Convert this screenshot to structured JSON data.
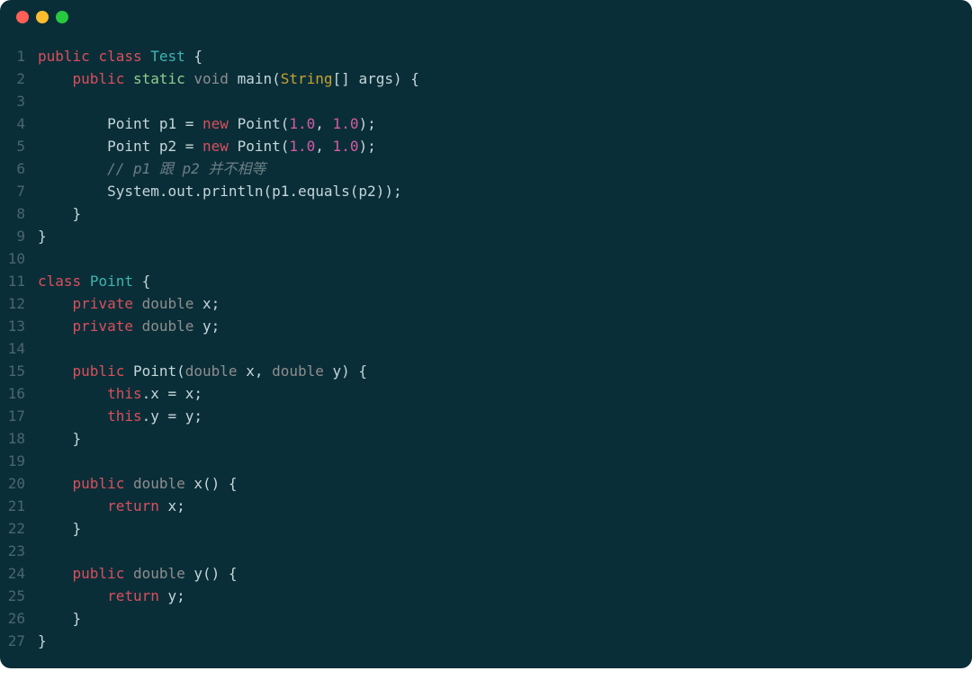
{
  "window": {
    "traffic_lights": [
      "red",
      "yellow",
      "green"
    ]
  },
  "code": {
    "lines": [
      {
        "n": "1",
        "tokens": [
          {
            "t": "public",
            "c": "kw"
          },
          {
            "t": " ",
            "c": ""
          },
          {
            "t": "class",
            "c": "kw"
          },
          {
            "t": " ",
            "c": ""
          },
          {
            "t": "Test",
            "c": "type"
          },
          {
            "t": " {",
            "c": "punct"
          }
        ]
      },
      {
        "n": "2",
        "tokens": [
          {
            "t": "    ",
            "c": ""
          },
          {
            "t": "public",
            "c": "kw"
          },
          {
            "t": " ",
            "c": ""
          },
          {
            "t": "static",
            "c": "modifier"
          },
          {
            "t": " ",
            "c": ""
          },
          {
            "t": "void",
            "c": "void"
          },
          {
            "t": " ",
            "c": ""
          },
          {
            "t": "main",
            "c": "method"
          },
          {
            "t": "(",
            "c": "punct"
          },
          {
            "t": "String",
            "c": "builtin"
          },
          {
            "t": "[] args) {",
            "c": "punct"
          }
        ]
      },
      {
        "n": "3",
        "tokens": []
      },
      {
        "n": "4",
        "tokens": [
          {
            "t": "        Point p1 = ",
            "c": "ident"
          },
          {
            "t": "new",
            "c": "kw"
          },
          {
            "t": " Point(",
            "c": "ident"
          },
          {
            "t": "1.0",
            "c": "num"
          },
          {
            "t": ", ",
            "c": "punct"
          },
          {
            "t": "1.0",
            "c": "num"
          },
          {
            "t": ");",
            "c": "punct"
          }
        ]
      },
      {
        "n": "5",
        "tokens": [
          {
            "t": "        Point p2 = ",
            "c": "ident"
          },
          {
            "t": "new",
            "c": "kw"
          },
          {
            "t": " Point(",
            "c": "ident"
          },
          {
            "t": "1.0",
            "c": "num"
          },
          {
            "t": ", ",
            "c": "punct"
          },
          {
            "t": "1.0",
            "c": "num"
          },
          {
            "t": ");",
            "c": "punct"
          }
        ]
      },
      {
        "n": "6",
        "tokens": [
          {
            "t": "        ",
            "c": ""
          },
          {
            "t": "// p1 跟 p2 并不相等",
            "c": "comment"
          }
        ]
      },
      {
        "n": "7",
        "tokens": [
          {
            "t": "        System.out.println(p1.equals(p2));",
            "c": "ident"
          }
        ]
      },
      {
        "n": "8",
        "tokens": [
          {
            "t": "    }",
            "c": "punct"
          }
        ]
      },
      {
        "n": "9",
        "tokens": [
          {
            "t": "}",
            "c": "punct"
          }
        ]
      },
      {
        "n": "10",
        "tokens": []
      },
      {
        "n": "11",
        "tokens": [
          {
            "t": "class",
            "c": "kw"
          },
          {
            "t": " ",
            "c": ""
          },
          {
            "t": "Point",
            "c": "type"
          },
          {
            "t": " {",
            "c": "punct"
          }
        ]
      },
      {
        "n": "12",
        "tokens": [
          {
            "t": "    ",
            "c": ""
          },
          {
            "t": "private",
            "c": "kw"
          },
          {
            "t": " ",
            "c": ""
          },
          {
            "t": "double",
            "c": "void"
          },
          {
            "t": " x;",
            "c": "ident"
          }
        ]
      },
      {
        "n": "13",
        "tokens": [
          {
            "t": "    ",
            "c": ""
          },
          {
            "t": "private",
            "c": "kw"
          },
          {
            "t": " ",
            "c": ""
          },
          {
            "t": "double",
            "c": "void"
          },
          {
            "t": " y;",
            "c": "ident"
          }
        ]
      },
      {
        "n": "14",
        "tokens": []
      },
      {
        "n": "15",
        "tokens": [
          {
            "t": "    ",
            "c": ""
          },
          {
            "t": "public",
            "c": "kw"
          },
          {
            "t": " Point(",
            "c": "ident"
          },
          {
            "t": "double",
            "c": "void"
          },
          {
            "t": " x, ",
            "c": "ident"
          },
          {
            "t": "double",
            "c": "void"
          },
          {
            "t": " y) {",
            "c": "ident"
          }
        ]
      },
      {
        "n": "16",
        "tokens": [
          {
            "t": "        ",
            "c": ""
          },
          {
            "t": "this",
            "c": "kw"
          },
          {
            "t": ".x = x;",
            "c": "ident"
          }
        ]
      },
      {
        "n": "17",
        "tokens": [
          {
            "t": "        ",
            "c": ""
          },
          {
            "t": "this",
            "c": "kw"
          },
          {
            "t": ".y = y;",
            "c": "ident"
          }
        ]
      },
      {
        "n": "18",
        "tokens": [
          {
            "t": "    }",
            "c": "punct"
          }
        ]
      },
      {
        "n": "19",
        "tokens": []
      },
      {
        "n": "20",
        "tokens": [
          {
            "t": "    ",
            "c": ""
          },
          {
            "t": "public",
            "c": "kw"
          },
          {
            "t": " ",
            "c": ""
          },
          {
            "t": "double",
            "c": "void"
          },
          {
            "t": " x() {",
            "c": "ident"
          }
        ]
      },
      {
        "n": "21",
        "tokens": [
          {
            "t": "        ",
            "c": ""
          },
          {
            "t": "return",
            "c": "kw"
          },
          {
            "t": " x;",
            "c": "ident"
          }
        ]
      },
      {
        "n": "22",
        "tokens": [
          {
            "t": "    }",
            "c": "punct"
          }
        ]
      },
      {
        "n": "23",
        "tokens": []
      },
      {
        "n": "24",
        "tokens": [
          {
            "t": "    ",
            "c": ""
          },
          {
            "t": "public",
            "c": "kw"
          },
          {
            "t": " ",
            "c": ""
          },
          {
            "t": "double",
            "c": "void"
          },
          {
            "t": " y() {",
            "c": "ident"
          }
        ]
      },
      {
        "n": "25",
        "tokens": [
          {
            "t": "        ",
            "c": ""
          },
          {
            "t": "return",
            "c": "kw"
          },
          {
            "t": " y;",
            "c": "ident"
          }
        ]
      },
      {
        "n": "26",
        "tokens": [
          {
            "t": "    }",
            "c": "punct"
          }
        ]
      },
      {
        "n": "27",
        "tokens": [
          {
            "t": "}",
            "c": "punct"
          }
        ]
      }
    ]
  }
}
